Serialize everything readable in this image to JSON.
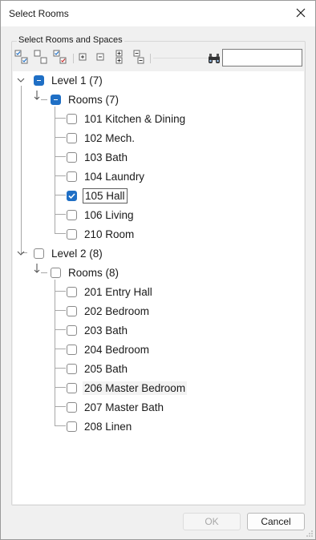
{
  "window": {
    "title": "Select Rooms"
  },
  "group": {
    "label": "Select Rooms and Spaces"
  },
  "toolbar": {
    "find_value": ""
  },
  "tree": {
    "level1": {
      "label": "Level 1 (7)",
      "rooms_label": "Rooms (7)",
      "items": [
        "101 Kitchen & Dining",
        "102 Mech.",
        "103 Bath",
        "104 Laundry",
        "105 Hall",
        "106 Living",
        "210 Room"
      ]
    },
    "level2": {
      "label": "Level 2 (8)",
      "rooms_label": "Rooms (8)",
      "items": [
        "201 Entry Hall",
        "202 Bedroom",
        "203 Bath",
        "204 Bedroom",
        "205 Bath",
        "206 Master Bedroom",
        "207 Master Bath",
        "208 Linen"
      ]
    }
  },
  "footer": {
    "ok_label": "OK",
    "cancel_label": "Cancel"
  },
  "colors": {
    "accent": "#1f6fc5",
    "disabled_text": "#a8a8a8"
  }
}
